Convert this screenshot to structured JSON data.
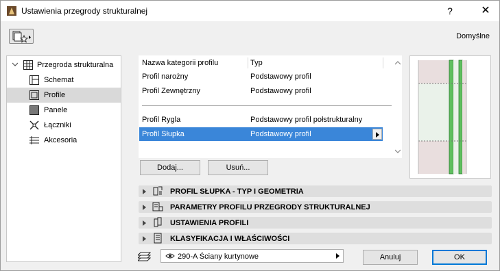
{
  "window": {
    "title": "Ustawienia przegrody strukturalnej",
    "help_label": "?",
    "close_label": "✕",
    "defaults_label": "Domyślne"
  },
  "tree": {
    "root": {
      "label": "Przegroda strukturalna",
      "icon": "grid-wall-icon"
    },
    "items": [
      {
        "label": "Schemat",
        "icon": "scheme-icon",
        "selected": false
      },
      {
        "label": "Profile",
        "icon": "profile-icon",
        "selected": true
      },
      {
        "label": "Panele",
        "icon": "panel-icon",
        "selected": false
      },
      {
        "label": "Łączniki",
        "icon": "connector-icon",
        "selected": false
      },
      {
        "label": "Akcesoria",
        "icon": "accessory-icon",
        "selected": false
      }
    ]
  },
  "profile_table": {
    "headers": [
      "Nazwa kategorii profilu",
      "Typ"
    ],
    "rows": [
      {
        "name": "Profil narożny",
        "type": "Podstawowy profil",
        "selected": false
      },
      {
        "name": "Profil Zewnętrzny",
        "type": "Podstawowy profil",
        "selected": false
      },
      {
        "name": "Profil Rygla",
        "type": "Podstawowy profil połstrukturalny",
        "selected": false
      },
      {
        "name": "Profil Słupka",
        "type": "Podstawowy profil",
        "selected": true
      }
    ]
  },
  "buttons": {
    "add": "Dodaj...",
    "remove": "Usuń...",
    "cancel": "Anuluj",
    "ok": "OK"
  },
  "panels": [
    {
      "label": "PROFIL SŁUPKA - TYP I GEOMETRIA",
      "icon": "profile-geometry-icon"
    },
    {
      "label": "PARAMETRY PROFILU PRZEGRODY STRUKTURALNEJ",
      "icon": "parameters-icon"
    },
    {
      "label": "USTAWIENIA PROFILI",
      "icon": "profile-settings-icon"
    },
    {
      "label": "KLASYFIKACJA I WŁAŚCIWOŚCI",
      "icon": "classification-icon"
    }
  ],
  "footer": {
    "layer_value": "290-A Ściany kurtynowe"
  },
  "colors": {
    "selection": "#3a86d9",
    "preview_green": "#4caf50",
    "preview_panel": "#e8d8d8",
    "ok_border": "#0078d7"
  }
}
